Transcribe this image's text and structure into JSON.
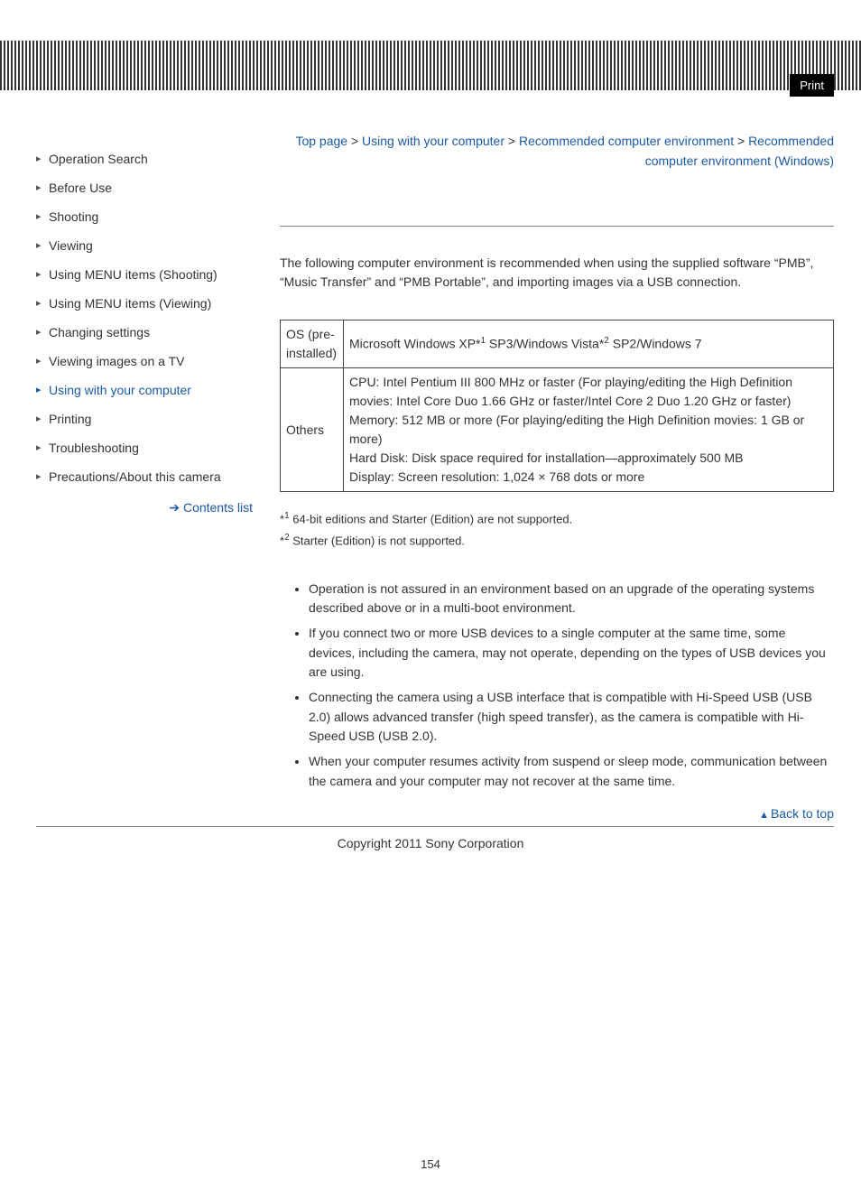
{
  "header": {
    "print_label": "Print"
  },
  "sidebar": {
    "items": [
      {
        "label": "Operation Search"
      },
      {
        "label": "Before Use"
      },
      {
        "label": "Shooting"
      },
      {
        "label": "Viewing"
      },
      {
        "label": "Using MENU items (Shooting)"
      },
      {
        "label": "Using MENU items (Viewing)"
      },
      {
        "label": "Changing settings"
      },
      {
        "label": "Viewing images on a TV"
      },
      {
        "label": "Using with your computer"
      },
      {
        "label": "Printing"
      },
      {
        "label": "Troubleshooting"
      },
      {
        "label": "Precautions/About this camera"
      }
    ],
    "contents_list": "Contents list"
  },
  "breadcrumb": {
    "top": "Top page",
    "l1": "Using with your computer",
    "l2": "Recommended computer environment",
    "current": "Recommended computer environment (Windows)",
    "sep": " > "
  },
  "intro": "The following computer environment is recommended when using the supplied software “PMB”, “Music Transfer” and “PMB Portable”, and importing images via a USB connection.",
  "table": {
    "row0": {
      "label": "OS (pre-installed)",
      "value_pre": "Microsoft Windows XP*",
      "value_mid": " SP3/Windows Vista*",
      "value_post": " SP2/Windows 7",
      "sup1": "1",
      "sup2": "2"
    },
    "row1": {
      "label": "Others",
      "line1": "CPU: Intel Pentium III 800 MHz or faster (For playing/editing the High Definition movies: Intel Core Duo 1.66 GHz or faster/Intel Core 2 Duo 1.20 GHz or faster)",
      "line2": "Memory: 512 MB or more (For playing/editing the High Definition movies: 1 GB or more)",
      "line3": "Hard Disk: Disk space required for installation—approximately 500 MB",
      "line4": "Display: Screen resolution: 1,024 × 768 dots or more"
    }
  },
  "footnotes": {
    "f1_mark": "*",
    "f1_sup": "1",
    "f1_text": " 64-bit editions and Starter (Edition) are not supported.",
    "f2_mark": "*",
    "f2_sup": "2",
    "f2_text": " Starter (Edition) is not supported."
  },
  "notes": [
    "Operation is not assured in an environment based on an upgrade of the operating systems described above or in a multi-boot environment.",
    "If you connect two or more USB devices to a single computer at the same time, some devices, including the camera, may not operate, depending on the types of USB devices you are using.",
    "Connecting the camera using a USB interface that is compatible with Hi-Speed USB (USB 2.0) allows advanced transfer (high speed transfer), as the camera is compatible with Hi-Speed USB (USB 2.0).",
    "When your computer resumes activity from suspend or sleep mode, communication between the camera and your computer may not recover at the same time."
  ],
  "backtop": "Back to top",
  "copyright": "Copyright 2011 Sony Corporation",
  "page_number": "154"
}
